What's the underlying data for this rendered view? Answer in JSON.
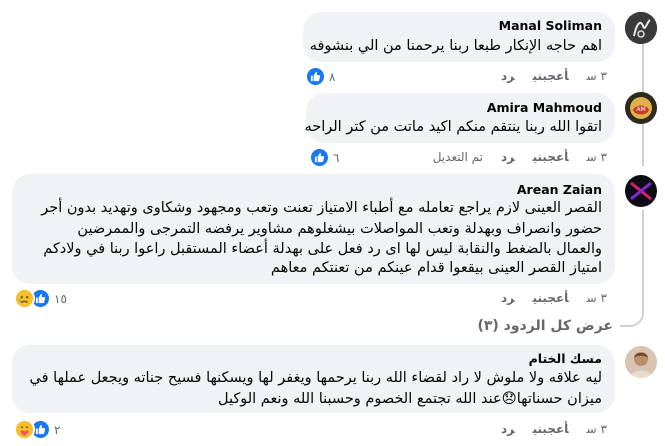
{
  "comments": [
    {
      "author": "Manal Soliman",
      "text_lines": [
        "اهم حاجه الإنكار طبعا ربنا يرحمنا من الي بنشوفه"
      ],
      "time": "٣ س",
      "like_label": "أعجبني",
      "reply_label": "رد",
      "edited_label": "",
      "reaction_count": "٨"
    },
    {
      "author": "Amira Mahmoud",
      "text_lines": [
        "اتقوا الله ربنا ينتقم منكم اكيد ماتت من كتر الراحه"
      ],
      "time": "٣ س",
      "like_label": "أعجبني",
      "reply_label": "رد",
      "edited_label": "تم التعديل",
      "reaction_count": "٦"
    },
    {
      "author": "Arean Zaian",
      "text_lines": [
        "القصر العينى لازم يراجع تعامله مع أطباء الامتياز تعنت وتعب ومجهود وشكاوى وتهديد بدون أجر",
        "حضور وانصراف وبهدلة وتعب المواصلات بيشغلوهم مشاوير يرفضه التمرجى والممرضين",
        "والعمال بالضغط والنقابة ليس لها اى رد فعل على بهدلة أعضاء المستقبل راعوا ربنا في ولادكم",
        "امتياز القصر العينى بيقعوا قدام عينكم من تعنتكم معاهم"
      ],
      "time": "٣ س",
      "like_label": "أعجبني",
      "reply_label": "رد",
      "edited_label": "",
      "reaction_count": "١٥"
    },
    {
      "author": "مسك الختام",
      "text_lines": [
        "ليه علاقه ولا ملوش لا راد لقضاء الله ربنا يرحمها ويغفر لها ويسكنها فسيح جناته ويجعل عملها في",
        "ميزان حسناتها😞عند الله تجتمع الخصوم وحسبنا الله ونعم الوكيل"
      ],
      "time": "٣ س",
      "like_label": "أعجبني",
      "reply_label": "رد",
      "edited_label": "",
      "reaction_count": "٢"
    }
  ],
  "view_more_replies": "عرض كل الردود (٣)",
  "colors": {
    "bubble": "#f0f2f5",
    "meta_text": "#65676b",
    "like_blue": "#1877f2",
    "thread_line": "#ced0d4"
  },
  "icons": [
    "like-reaction-icon",
    "sad-reaction-icon",
    "care-reaction-icon"
  ]
}
